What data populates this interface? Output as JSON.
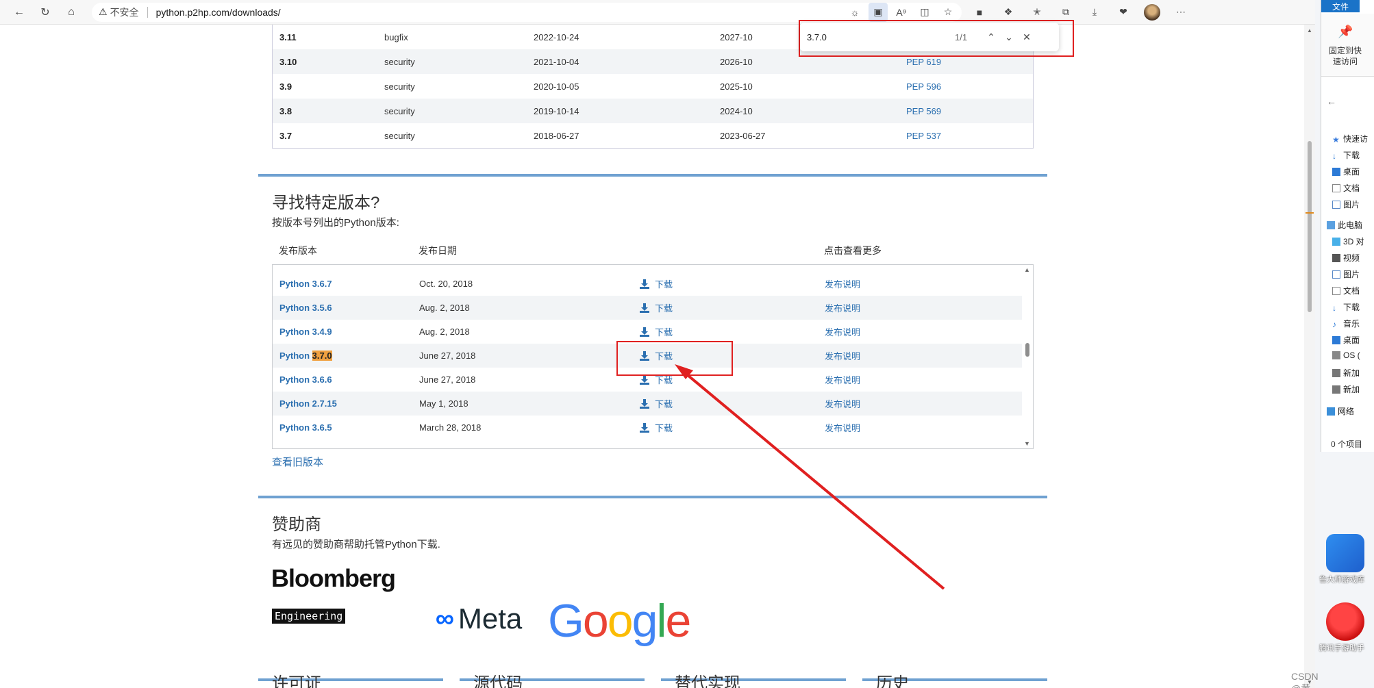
{
  "browser": {
    "security_label": "不安全",
    "url": "python.p2hp.com/downloads/"
  },
  "find_bar": {
    "query": "3.7.0",
    "count": "1/1"
  },
  "release_cycle": {
    "rows": [
      {
        "version": "3.11",
        "status": "bugfix",
        "first_release": "2022-10-24",
        "end_of_support": "2027-10",
        "pep": ""
      },
      {
        "version": "3.10",
        "status": "security",
        "first_release": "2021-10-04",
        "end_of_support": "2026-10",
        "pep": "PEP 619"
      },
      {
        "version": "3.9",
        "status": "security",
        "first_release": "2020-10-05",
        "end_of_support": "2025-10",
        "pep": "PEP 596"
      },
      {
        "version": "3.8",
        "status": "security",
        "first_release": "2019-10-14",
        "end_of_support": "2024-10",
        "pep": "PEP 569"
      },
      {
        "version": "3.7",
        "status": "security",
        "first_release": "2018-06-27",
        "end_of_support": "2023-06-27",
        "pep": "PEP 537"
      }
    ]
  },
  "specific_release": {
    "title": "寻找特定版本?",
    "subtitle": "按版本号列出的Python版本:",
    "headers": [
      "发布版本",
      "发布日期",
      "点击查看更多"
    ],
    "rows": [
      {
        "prefix": "Python ",
        "version": "3.6.7",
        "date": "Oct. 20, 2018",
        "download": "下载",
        "notes": "发布说明"
      },
      {
        "prefix": "Python ",
        "version": "3.5.6",
        "date": "Aug. 2, 2018",
        "download": "下载",
        "notes": "发布说明"
      },
      {
        "prefix": "Python ",
        "version": "3.4.9",
        "date": "Aug. 2, 2018",
        "download": "下载",
        "notes": "发布说明"
      },
      {
        "prefix": "Python ",
        "version": "3.7.0",
        "date": "June 27, 2018",
        "download": "下载",
        "notes": "发布说明"
      },
      {
        "prefix": "Python ",
        "version": "3.6.6",
        "date": "June 27, 2018",
        "download": "下载",
        "notes": "发布说明"
      },
      {
        "prefix": "Python ",
        "version": "2.7.15",
        "date": "May 1, 2018",
        "download": "下载",
        "notes": "发布说明"
      },
      {
        "prefix": "Python ",
        "version": "3.6.5",
        "date": "March 28, 2018",
        "download": "下载",
        "notes": "发布说明"
      }
    ],
    "older_link": "查看旧版本"
  },
  "sponsors": {
    "title": "赞助商",
    "subtitle": "有远见的赞助商帮助托管Python下载.",
    "bloomberg": "Bloomberg",
    "bloomberg_sub": "Engineering",
    "meta": "Meta",
    "google": [
      "G",
      "o",
      "o",
      "g",
      "l",
      "e"
    ]
  },
  "footer": {
    "columns": [
      "许可证",
      "源代码",
      "替代实现",
      "历史"
    ]
  },
  "watermark": "CSDN @黄拾安",
  "explorer": {
    "tab": "文件",
    "pin_label": "固定到快速访问",
    "items": [
      "快速访",
      "下载",
      "桌面",
      "文档",
      "图片",
      "此电脑",
      "3D 对",
      "视频",
      "图片",
      "文档",
      "下载",
      "音乐",
      "桌面",
      "OS (",
      "新加",
      "新加",
      "网络"
    ],
    "status": "0 个项目"
  },
  "desktop": {
    "icon1_label": "鲁大师游戏库",
    "icon2_label": "腾讯手游助手"
  },
  "colors": {
    "link": "#2b6fb0",
    "accent_bar": "#6fa1d1",
    "highlight": "#f0a040",
    "annotation": "#e02020"
  }
}
